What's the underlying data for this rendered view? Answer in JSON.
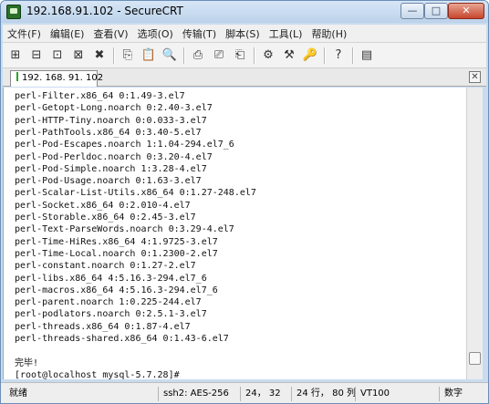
{
  "window": {
    "title": "192.168.91.102 - SecureCRT",
    "minimize": "—",
    "maximize": "□",
    "close": "✕"
  },
  "menu": [
    "文件(F)",
    "编辑(E)",
    "查看(V)",
    "选项(O)",
    "传输(T)",
    "脚本(S)",
    "工具(L)",
    "帮助(H)"
  ],
  "toolbar": {
    "icons": [
      "connect-icon",
      "quick-connect-icon",
      "connect-tab-icon",
      "reconnect-icon",
      "disconnect-icon",
      "copy-icon",
      "paste-icon",
      "find-icon",
      "print-setup-icon",
      "print-icon",
      "printer-icon",
      "session-options-icon",
      "global-options-icon",
      "keymap-icon",
      "help-icon",
      "sftp-icon"
    ],
    "glyphs": [
      "⊞",
      "⊟",
      "⊡",
      "⊠",
      "✖",
      "⎘",
      "📋",
      "🔍",
      "⎙",
      "⎚",
      "⎗",
      "⚙",
      "⚒",
      "🔑",
      "?",
      "▤"
    ]
  },
  "tab": {
    "label": "192. 168. 91. 102",
    "close": "✕"
  },
  "terminal": {
    "lines": [
      "perl-Filter.x86_64 0:1.49-3.el7",
      "perl-Getopt-Long.noarch 0:2.40-3.el7",
      "perl-HTTP-Tiny.noarch 0:0.033-3.el7",
      "perl-PathTools.x86_64 0:3.40-5.el7",
      "perl-Pod-Escapes.noarch 1:1.04-294.el7_6",
      "perl-Pod-Perldoc.noarch 0:3.20-4.el7",
      "perl-Pod-Simple.noarch 1:3.28-4.el7",
      "perl-Pod-Usage.noarch 0:1.63-3.el7",
      "perl-Scalar-List-Utils.x86_64 0:1.27-248.el7",
      "perl-Socket.x86_64 0:2.010-4.el7",
      "perl-Storable.x86_64 0:2.45-3.el7",
      "perl-Text-ParseWords.noarch 0:3.29-4.el7",
      "perl-Time-HiRes.x86_64 4:1.9725-3.el7",
      "perl-Time-Local.noarch 0:1.2300-2.el7",
      "perl-constant.noarch 0:1.27-2.el7",
      "perl-libs.x86_64 4:5.16.3-294.el7_6",
      "perl-macros.x86_64 4:5.16.3-294.el7_6",
      "perl-parent.noarch 1:0.225-244.el7",
      "perl-podlators.noarch 0:2.5.1-3.el7",
      "perl-threads.x86_64 0:1.87-4.el7",
      "perl-threads-shared.x86_64 0:1.43-6.el7",
      "",
      "完毕!",
      "[root@localhost mysql-5.7.28]#"
    ]
  },
  "status": {
    "ready": "就绪",
    "cipher": "ssh2: AES-256",
    "cursor": "24， 32",
    "size": "24 行， 80 列",
    "terminal_type": "VT100",
    "numlock": "数字"
  }
}
